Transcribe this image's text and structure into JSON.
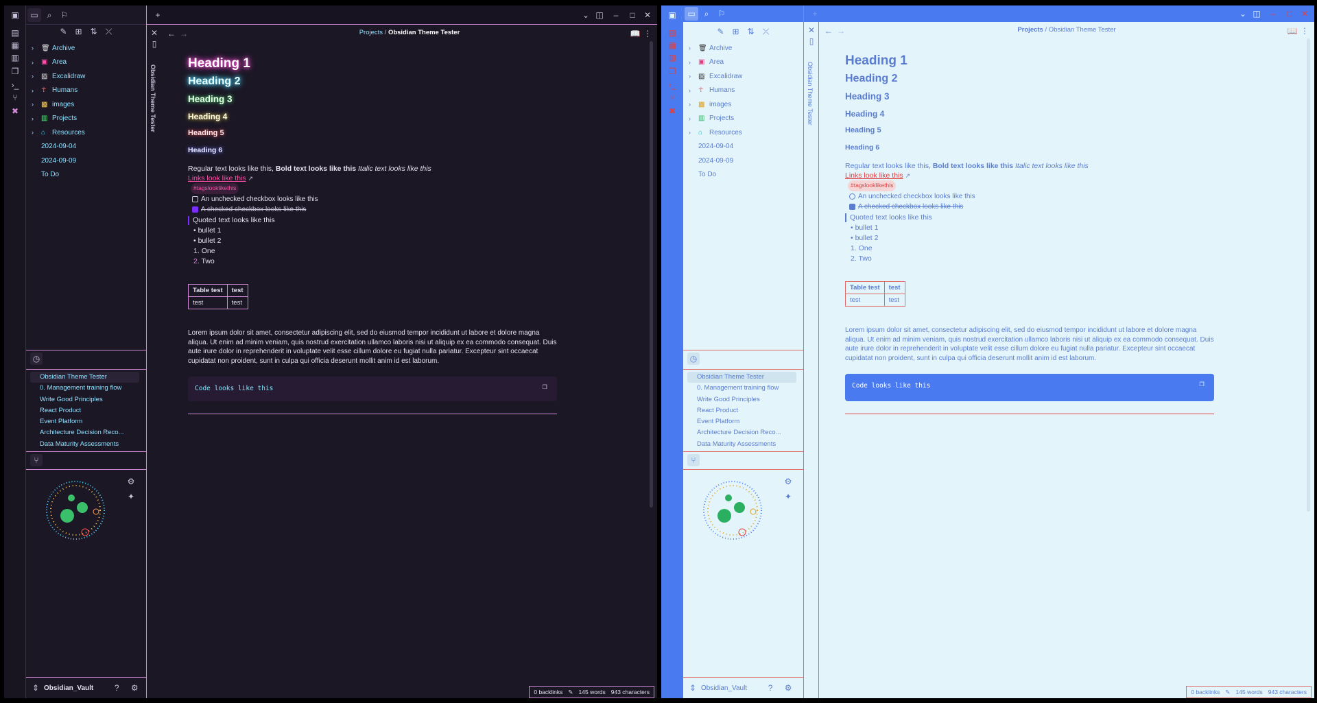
{
  "breadcrumb": {
    "folder": "Projects",
    "separator": "/",
    "file": "Obsidian Theme Tester"
  },
  "tab_title": "Obsidian Theme Tester",
  "tree": {
    "folders": [
      {
        "label": "Archive",
        "icon": "trash-icon"
      },
      {
        "label": "Area",
        "icon": "briefcase-icon"
      },
      {
        "label": "Excalidraw",
        "icon": "image-icon"
      },
      {
        "label": "Humans",
        "icon": "person-icon"
      },
      {
        "label": "images",
        "icon": "picture-icon"
      },
      {
        "label": "Projects",
        "icon": "project-icon"
      },
      {
        "label": "Resources",
        "icon": "inbox-icon"
      }
    ],
    "files": [
      "2024-09-04",
      "2024-09-09",
      "To Do"
    ]
  },
  "recent": [
    "Obsidian Theme Tester",
    "0. Management training flow",
    "Write Good Principles",
    "React Product",
    "Event Platform",
    "Architecture Decision Reco...",
    "Data Maturity Assessments"
  ],
  "vault": "Obsidian_Vault",
  "doc": {
    "h1": "Heading 1",
    "h2": "Heading 2",
    "h3": "Heading 3",
    "h4": "Heading 4",
    "h5": "Heading 5",
    "h6": "Heading 6",
    "regular": "Regular text looks like this, ",
    "bold": "Bold text looks like this",
    "italic": " Italic text looks like this",
    "link": "Links look like this",
    "tag": "#tagslooklikethis",
    "unchecked": "An unchecked checkbox looks like this",
    "checked": "A checked checkbox looks like this",
    "quote": "Quoted text looks like this",
    "bullets": [
      "bullet 1",
      "bullet 2"
    ],
    "numbered": [
      "One",
      "Two"
    ],
    "table": {
      "headers": [
        "Table test",
        "test"
      ],
      "row": [
        "test",
        "test"
      ]
    },
    "lorem": "Lorem ipsum dolor sit amet, consectetur adipiscing elit, sed do eiusmod tempor incididunt ut labore et dolore magna aliqua. Ut enim ad minim veniam, quis nostrud exercitation ullamco laboris nisi ut aliquip ex ea commodo consequat. Duis aute irure dolor in reprehenderit in voluptate velit esse cillum dolore eu fugiat nulla pariatur. Excepteur sint occaecat cupidatat non proident, sunt in culpa qui officia deserunt mollit anim id est laborum.",
    "code": "Code looks like this"
  },
  "status": {
    "backlinks": "0 backlinks",
    "words": "145 words",
    "chars": "943 characters"
  },
  "icons": {
    "new": "+",
    "min": "–",
    "max": "□",
    "close": "✕",
    "back": "←",
    "fwd": "→"
  }
}
